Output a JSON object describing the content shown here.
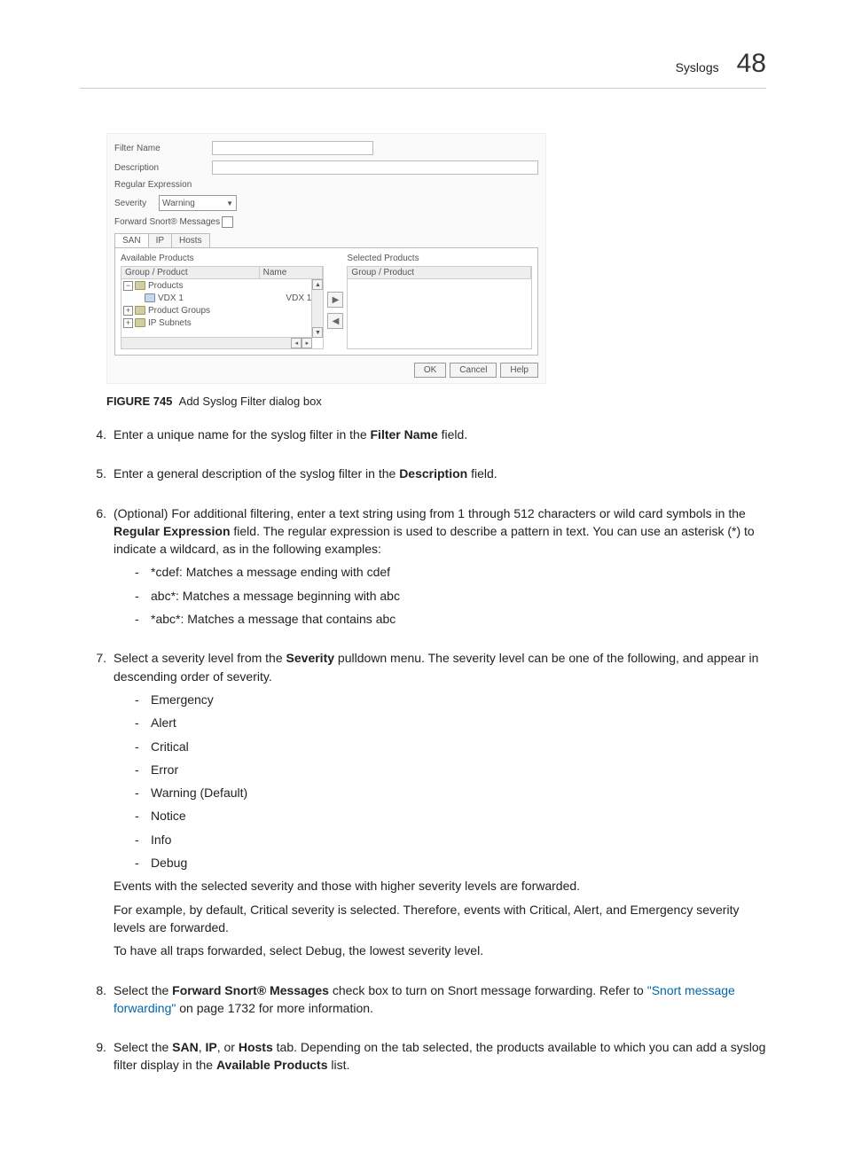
{
  "header": {
    "section": "Syslogs",
    "chapter": "48"
  },
  "dialog": {
    "labels": {
      "filterName": "Filter Name",
      "description": "Description",
      "regex": "Regular Expression",
      "severity": "Severity",
      "severityValue": "Warning",
      "forwardSnort": "Forward Snort® Messages"
    },
    "tabs": {
      "san": "SAN",
      "ip": "IP",
      "hosts": "Hosts"
    },
    "panels": {
      "availableTitle": "Available Products",
      "selectedTitle": "Selected Products",
      "colGroupProduct": "Group / Product",
      "colName": "Name"
    },
    "tree": {
      "products": "Products",
      "vdx1": "VDX 1",
      "vdx1name": "VDX 1",
      "productGroups": "Product Groups",
      "ipSubnets": "IP Subnets"
    },
    "buttons": {
      "ok": "OK",
      "cancel": "Cancel",
      "help": "Help"
    }
  },
  "figure": {
    "label": "FIGURE 745",
    "caption": "Add Syslog Filter dialog box"
  },
  "steps": {
    "s4": {
      "num": "4.",
      "t1": "Enter a unique name for the syslog filter in the ",
      "b1": "Filter Name",
      "t2": " field."
    },
    "s5": {
      "num": "5.",
      "t1": "Enter a general description of the syslog filter in the ",
      "b1": "Description",
      "t2": " field."
    },
    "s6": {
      "num": "6.",
      "t1": "(Optional) For additional filtering, enter a text string using from 1 through 512 characters or wild card symbols in the ",
      "b1": "Regular Expression",
      "t2": " field. The regular expression is used to describe a pattern in text. You can use an asterisk (*) to indicate a wildcard, as in the following examples:",
      "li1": "*cdef: Matches a message ending with cdef",
      "li2": "abc*: Matches a message beginning with abc",
      "li3": "*abc*: Matches a message that contains abc"
    },
    "s7": {
      "num": "7.",
      "t1": "Select a severity level from the ",
      "b1": "Severity",
      "t2": " pulldown menu. The severity level can be one of the following, and appear in descending order of severity.",
      "li1": "Emergency",
      "li2": "Alert",
      "li3": "Critical",
      "li4": "Error",
      "li5": "Warning (Default)",
      "li6": "Notice",
      "li7": "Info",
      "li8": "Debug",
      "p1": "Events with the selected severity and those with higher severity levels are forwarded.",
      "p2": "For example, by default, Critical severity is selected. Therefore, events with Critical, Alert, and Emergency severity levels are forwarded.",
      "p3": "To have all traps forwarded, select Debug, the lowest severity level."
    },
    "s8": {
      "num": "8.",
      "t1": "Select the ",
      "b1": "Forward Snort® Messages",
      "t2": " check box to turn on Snort message forwarding. Refer to ",
      "link": "\"Snort message forwarding\"",
      "t3": " on page 1732 for more information."
    },
    "s9": {
      "num": "9.",
      "t1": "Select the ",
      "b1": "SAN",
      "t2": ", ",
      "b2": "IP",
      "t3": ", or ",
      "b3": "Hosts",
      "t4": " tab. Depending on the tab selected, the products available to which you can add a syslog filter display in the ",
      "b4": "Available Products",
      "t5": " list."
    }
  }
}
